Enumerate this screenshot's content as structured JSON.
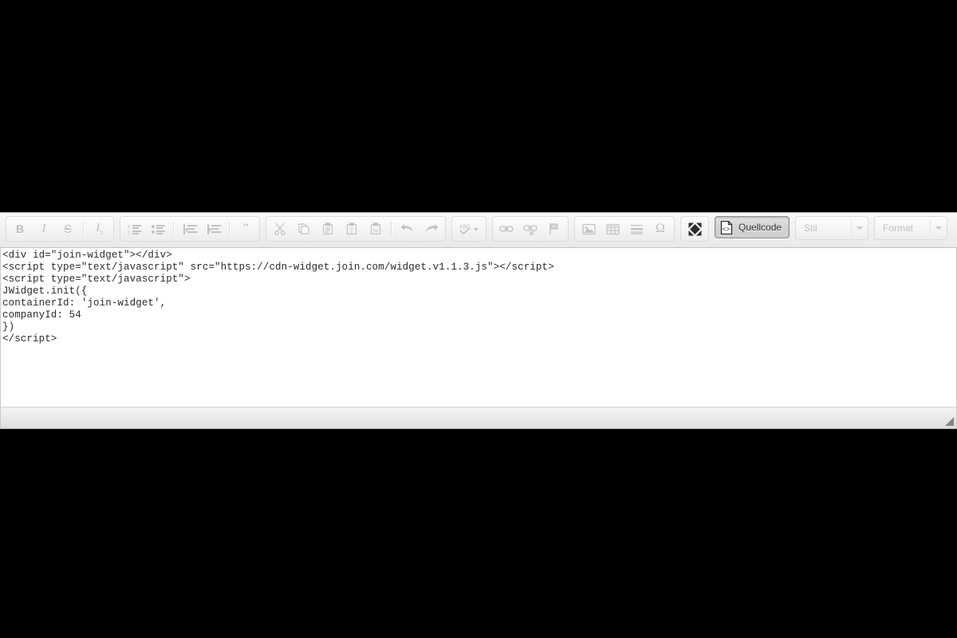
{
  "editor": {
    "name": "CKEditor rich text editor",
    "mode": "source",
    "toolbar": {
      "groups": [
        {
          "name": "basic-styles",
          "items": [
            {
              "id": "bold",
              "icon": "bold-icon",
              "label": "B",
              "title": "Fett",
              "enabled": false
            },
            {
              "id": "italic",
              "icon": "italic-icon",
              "label": "I",
              "title": "Kursiv",
              "enabled": false
            },
            {
              "id": "strike",
              "icon": "strikethrough-icon",
              "label": "S",
              "title": "Durchgestrichen",
              "enabled": false
            },
            {
              "id": "removeformat",
              "icon": "remove-format-icon",
              "label": "Ix",
              "title": "Formatierung entfernen",
              "enabled": false
            }
          ]
        },
        {
          "name": "paragraph",
          "items": [
            {
              "id": "numberedlist",
              "icon": "numbered-list-icon",
              "title": "Nummerierte Liste",
              "enabled": false
            },
            {
              "id": "bulletedlist",
              "icon": "bulleted-list-icon",
              "title": "Liste",
              "enabled": false
            },
            {
              "id": "outdent",
              "icon": "outdent-icon",
              "title": "Einzug verkleinern",
              "enabled": false
            },
            {
              "id": "indent",
              "icon": "indent-icon",
              "title": "Einzug vergrößern",
              "enabled": false
            },
            {
              "id": "blockquote",
              "icon": "blockquote-icon",
              "title": "Zitatblock",
              "enabled": false
            }
          ]
        },
        {
          "name": "clipboard",
          "items": [
            {
              "id": "cut",
              "icon": "scissors-icon",
              "title": "Ausschneiden",
              "enabled": false
            },
            {
              "id": "copy",
              "icon": "copy-icon",
              "title": "Kopieren",
              "enabled": false
            },
            {
              "id": "paste",
              "icon": "paste-icon",
              "title": "Einfügen",
              "enabled": false
            },
            {
              "id": "pastetext",
              "icon": "paste-text-icon",
              "title": "Als Text einfügen",
              "enabled": false
            },
            {
              "id": "pastefromword",
              "icon": "paste-from-word-icon",
              "title": "Aus Word einfügen",
              "enabled": false
            },
            {
              "id": "undo",
              "icon": "undo-arrow-icon",
              "title": "Rückgängig",
              "enabled": false
            },
            {
              "id": "redo",
              "icon": "redo-arrow-icon",
              "title": "Wiederherstellen",
              "enabled": false
            }
          ]
        },
        {
          "name": "spellcheck",
          "items": [
            {
              "id": "scayt",
              "icon": "spellcheck-abc-icon",
              "title": "Rechtschreibprüfung",
              "enabled": false,
              "has_dropdown": true
            }
          ]
        },
        {
          "name": "links",
          "items": [
            {
              "id": "link",
              "icon": "link-chain-icon",
              "title": "Link einfügen",
              "enabled": false
            },
            {
              "id": "unlink",
              "icon": "unlink-chain-icon",
              "title": "Link entfernen",
              "enabled": false
            },
            {
              "id": "anchor",
              "icon": "anchor-flag-icon",
              "title": "Anker einfügen",
              "enabled": false
            }
          ]
        },
        {
          "name": "insert",
          "items": [
            {
              "id": "image",
              "icon": "image-icon",
              "title": "Bild einfügen",
              "enabled": false
            },
            {
              "id": "table",
              "icon": "table-grid-icon",
              "title": "Tabelle einfügen",
              "enabled": false
            },
            {
              "id": "horizontalrule",
              "icon": "horizontal-rule-icon",
              "title": "Horizontale Linie",
              "enabled": false
            },
            {
              "id": "specialchar",
              "icon": "omega-special-char-icon",
              "label": "Ω",
              "title": "Sonderzeichen",
              "enabled": false
            }
          ]
        },
        {
          "name": "tools",
          "items": [
            {
              "id": "maximize",
              "icon": "maximize-arrows-icon",
              "title": "Maximieren",
              "enabled": true
            }
          ]
        }
      ],
      "source_button": {
        "label": "Quellcode",
        "icon": "source-code-document-icon",
        "active": true
      },
      "combos": [
        {
          "id": "styles",
          "label": "Stil",
          "enabled": false
        },
        {
          "id": "format",
          "label": "Format",
          "enabled": false
        }
      ]
    },
    "source_code": "<div id=\"join-widget\"></div>\n<script type=\"text/javascript\" src=\"https://cdn-widget.join.com/widget.v1.1.3.js\"></script>\n<script type=\"text/javascript\">\nJWidget.init({\ncontainerId: 'join-widget',\ncompanyId: 54\n})\n</script>",
    "footer": {
      "resize_grip": "resize-grip-icon"
    }
  },
  "colors": {
    "page_background": "#000000",
    "toolbar_background": "#f1f1f1",
    "editor_background": "#ffffff",
    "text": "#2b2b2b",
    "disabled_icon": "#c2c2c2",
    "enabled_icon": "#555555",
    "active_button_border": "#8e8e8e"
  }
}
